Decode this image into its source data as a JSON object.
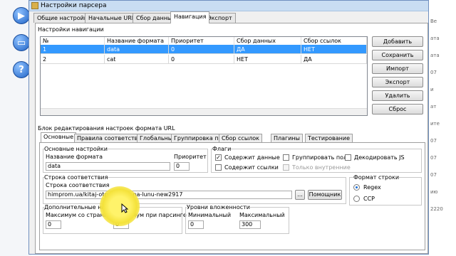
{
  "window": {
    "title": "Настройки парсера"
  },
  "tabs": [
    "Общие настройки",
    "Начальные URL",
    "Сбор данных",
    "Навигация",
    "Экспорт"
  ],
  "active_tab": "Навигация",
  "nav_settings": {
    "group_label": "Настройки навигации",
    "columns": [
      "№",
      "Название формата",
      "Приоритет",
      "Сбор данных",
      "Сбор ссылок"
    ],
    "rows": [
      [
        "1",
        "data",
        "0",
        "ДА",
        "НЕТ"
      ],
      [
        "2",
        "cat",
        "0",
        "НЕТ",
        "ДА"
      ]
    ],
    "selected_row": 0
  },
  "side_buttons": [
    "Добавить",
    "Сохранить",
    "Импорт",
    "Экспорт",
    "Удалить",
    "Сброс"
  ],
  "edit_block": {
    "label": "Блок редактирования настроек формата URL",
    "tabs": [
      "Основные",
      "Правила соответствия",
      "Глобальные замены",
      "Группировка полей",
      "Сбор ссылок",
      "Плагины",
      "Тестирование"
    ],
    "active_tab": "Основные",
    "basic": {
      "group_label": "Основные настройки",
      "name_label": "Название формата",
      "name_value": "data",
      "priority_label": "Приоритет",
      "priority_value": "0"
    },
    "flags": {
      "group_label": "Флаги",
      "items": [
        {
          "label": "Содержит данные",
          "checked": true,
          "disabled": false
        },
        {
          "label": "Группировать поля",
          "checked": false,
          "disabled": false
        },
        {
          "label": "Декодировать JS",
          "checked": false,
          "disabled": false
        },
        {
          "label": "Содержит ссылки",
          "checked": false,
          "disabled": false
        },
        {
          "label": "Только внутренние",
          "checked": false,
          "disabled": true
        }
      ]
    },
    "match": {
      "group_label": "Строка соответствия",
      "field_label": "Строка соответствия",
      "value": "himprom.ua/kitaj-otpravitsya-na-lunu-new2917",
      "browse_label": "...",
      "helper_label": "Помощник"
    },
    "format": {
      "group_label": "Формат строки",
      "options": [
        "Regex",
        "ССР"
      ],
      "selected": "Regex"
    },
    "extra": {
      "group_label": "Дополнительные настройки",
      "max_page_label": "Максимум со страницы",
      "max_page_value": "0",
      "max_parse_label": "Максимум при парсинге",
      "max_parse_value": "0"
    },
    "nesting": {
      "group_label": "Уровни вложенности",
      "min_label": "Минимальный",
      "min_value": "0",
      "max_label": "Максимальный",
      "max_value": "300"
    }
  },
  "right_strip_text": [
    "Be",
    "ата",
    "ата",
    "07",
    "и",
    "ат",
    "ите",
    "07",
    "07",
    "07",
    "ию",
    "2220"
  ],
  "colors": {
    "selection": "#3399ff",
    "titlebar": "#c9ddf2",
    "highlight": "#f4e23a"
  }
}
